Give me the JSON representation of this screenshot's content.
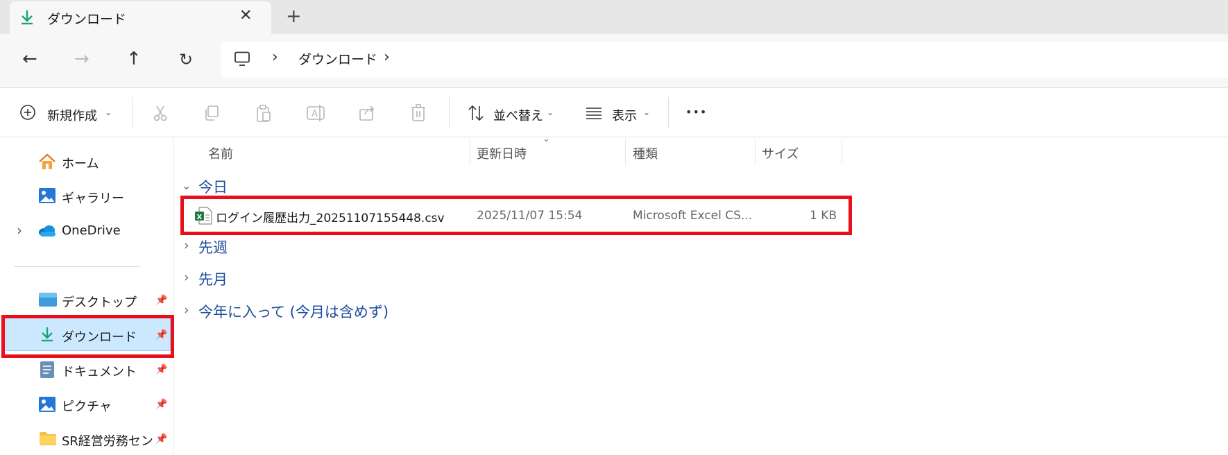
{
  "tab": {
    "title": "ダウンロード",
    "close": "✕",
    "new_tab": "+"
  },
  "address": {
    "crumb": "ダウンロード",
    "sep1": "›",
    "sep2": "›"
  },
  "nav_buttons": {
    "back": "←",
    "forward": "→",
    "up": "↑",
    "refresh": "↻"
  },
  "command_bar": {
    "new": "新規作成",
    "sort": "並べ替え",
    "view": "表示",
    "more": "•••",
    "chevron": "⌄"
  },
  "sidebar": {
    "home": "ホーム",
    "gallery": "ギャラリー",
    "onedrive": "OneDrive",
    "expand": "›",
    "desktop": "デスクトップ",
    "downloads": "ダウンロード",
    "documents": "ドキュメント",
    "pictures": "ピクチャ",
    "folder": "SR経営労務センタ",
    "pin": "📌"
  },
  "columns": {
    "name": "名前",
    "modified": "更新日時",
    "type": "種類",
    "size": "サイズ",
    "sort_indicator": "⌄"
  },
  "groups": {
    "today": "今日",
    "last_week": "先週",
    "last_month": "先月",
    "this_year": "今年に入って (今月は含めず)",
    "open_chev": "⌄",
    "closed_chev": "›"
  },
  "file": {
    "name": "ログイン履歴出力_20251107155448.csv",
    "modified": "2025/11/07 15:54",
    "type": "Microsoft Excel CS...",
    "size": "1 KB"
  },
  "colors": {
    "accent_folder": "#1c4d9c",
    "highlight": "#e8101a",
    "selected": "#cce8ff",
    "download_icon": "#1aa37a"
  }
}
